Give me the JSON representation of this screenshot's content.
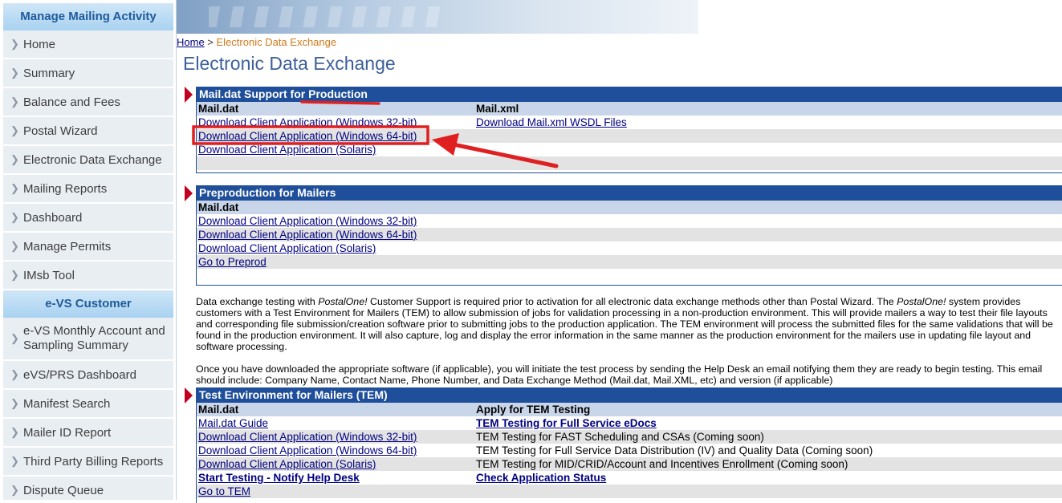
{
  "sidebar": {
    "section1_title": "Manage Mailing Activity",
    "section1_items": [
      "Home",
      "Summary",
      "Balance and Fees",
      "Postal Wizard",
      "Electronic Data Exchange",
      "Mailing Reports",
      "Dashboard",
      "Manage Permits",
      "IMsb Tool"
    ],
    "section2_title": "e-VS Customer",
    "section2_items": [
      "e-VS Monthly Account and Sampling Summary",
      "eVS/PRS Dashboard",
      "Manifest Search",
      "Mailer ID Report",
      "Third Party Billing Reports",
      "Dispute Queue"
    ]
  },
  "breadcrumb": {
    "home": "Home",
    "separator": " > ",
    "current": "Electronic Data Exchange"
  },
  "page_title": "Electronic Data Exchange",
  "production": {
    "title": "Mail.dat Support for Production",
    "col1_header": "Mail.dat",
    "col2_header": "Mail.xml",
    "link_win32": "Download Client Application (Windows 32-bit)",
    "link_win64": "Download Client Application (Windows 64-bit)",
    "link_solaris": "Download Client Application (Solaris)",
    "link_wsdl": "Download Mail.xml WSDL Files"
  },
  "preproduction": {
    "title": "Preproduction for Mailers",
    "col1_header": "Mail.dat",
    "link_win32": "Download Client Application (Windows 32-bit)",
    "link_win64": "Download Client Application (Windows 64-bit)",
    "link_solaris": "Download Client Application (Solaris)",
    "link_preprod": "Go to Preprod"
  },
  "info": {
    "p1_a": "Data exchange testing with ",
    "p1_brand": "PostalOne!",
    "p1_b": " Customer Support is required prior to activation for all electronic data exchange methods other than Postal Wizard. The ",
    "p1_brand2": "PostalOne!",
    "p1_c": " system provides customers with a Test Environment for Mailers (TEM) to allow submission of jobs for validation processing in a non-production environment. This will provide mailers a way to test their file layouts and corresponding file submission/creation software prior to submitting jobs to the production application. The TEM environment will process the submitted files for the same validations that will be found in the production environment. It will also capture, log and display the error information in the same manner as the production environment for the mailers use in updating file layout and software processing.",
    "p2": "Once you have downloaded the appropriate software (if applicable), you will initiate the test process by sending the Help Desk an email notifying them they are ready to begin testing. This email should include: Company Name, Contact Name, Phone Number, and Data Exchange Method (Mail.dat, Mail.XML, etc) and version (if applicable)"
  },
  "tem": {
    "title": "Test Environment for Mailers (TEM)",
    "col1_header": "Mail.dat",
    "col2_header": "Apply for TEM Testing",
    "link_guide": "Mail.dat Guide",
    "link_win32": "Download Client Application (Windows 32-bit)",
    "link_win64": "Download Client Application (Windows 64-bit)",
    "link_solaris": "Download Client Application (Solaris)",
    "link_start": "Start Testing - Notify Help Desk",
    "link_go": "Go to TEM",
    "apply_full_service": "TEM Testing for Full Service eDocs",
    "apply_fast": "TEM Testing for FAST Scheduling and CSAs (Coming soon)",
    "apply_fsdd": "TEM Testing for Full Service Data Distribution (IV) and Quality Data (Coming soon)",
    "apply_mid": "TEM Testing for MID/CRID/Account and Incentives Enrollment (Coming soon)",
    "apply_status": "Check Application Status"
  },
  "colors": {
    "section_header": "#1f4e9a",
    "annotation_red": "#e02020",
    "marker": "#c1001f"
  }
}
